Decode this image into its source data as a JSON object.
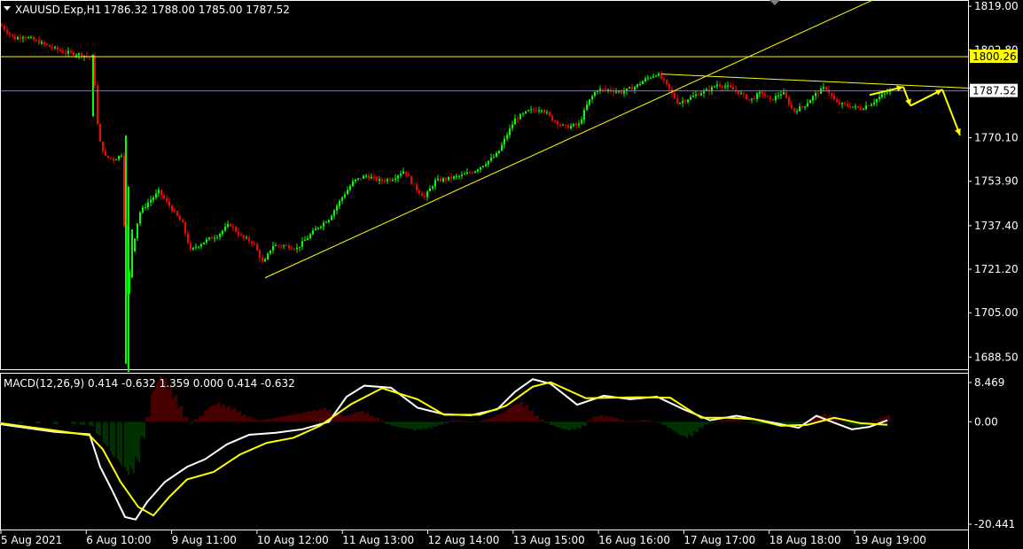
{
  "header": {
    "symbol_label": "XAUUSD.Exp,H1",
    "ohlc_label": "1786.32 1788.00 1785.00 1787.52"
  },
  "macd": {
    "label": "MACD(12,26,9) 0.414 -0.632 1.359 0.000 0.414 -0.632"
  },
  "colors": {
    "background": "#000000",
    "bull_candle": "#00ff00",
    "bear_candle": "#ff0000",
    "trendline": "#ffff00",
    "current_price_line": "#7f7f9f",
    "macd_line": "#ffffff",
    "signal_line": "#ffff00",
    "hist_positive": "#8b0000",
    "hist_negative": "#006400",
    "grid_frame": "#ffffff"
  },
  "chart_data": [
    {
      "type": "candlestick",
      "symbol": "XAUUSD.Exp",
      "timeframe": "H1",
      "y_ticks": [
        "1819.00",
        "1802.80",
        "1787.52",
        "1770.10",
        "1753.90",
        "1737.40",
        "1721.20",
        "1705.00",
        "1688.50"
      ],
      "ylim": [
        1684,
        1821
      ],
      "x_ticks": [
        "5 Aug 2021",
        "6 Aug 10:00",
        "9 Aug 11:00",
        "10 Aug 12:00",
        "11 Aug 13:00",
        "12 Aug 14:00",
        "13 Aug 15:00",
        "16 Aug 16:00",
        "17 Aug 17:00",
        "18 Aug 18:00",
        "19 Aug 19:00"
      ],
      "horizontal_level": {
        "price": 1800.26,
        "label": "1800.26"
      },
      "current_price": {
        "price": 1787.52,
        "label": "1787.52"
      },
      "price_path": [
        [
          0,
          1812
        ],
        [
          15,
          1807
        ],
        [
          25,
          1808
        ],
        [
          40,
          1806
        ],
        [
          55,
          1804
        ],
        [
          70,
          1802
        ],
        [
          90,
          1801
        ],
        [
          104,
          1800
        ],
        [
          110,
          1770
        ],
        [
          118,
          1763
        ],
        [
          128,
          1762
        ],
        [
          136,
          1764
        ],
        [
          142,
          1712
        ],
        [
          148,
          1728
        ],
        [
          156,
          1742
        ],
        [
          166,
          1746
        ],
        [
          178,
          1750
        ],
        [
          192,
          1744
        ],
        [
          205,
          1738
        ],
        [
          214,
          1728
        ],
        [
          222,
          1730
        ],
        [
          232,
          1732
        ],
        [
          245,
          1734
        ],
        [
          258,
          1738
        ],
        [
          272,
          1733
        ],
        [
          285,
          1731
        ],
        [
          296,
          1723
        ],
        [
          306,
          1730
        ],
        [
          320,
          1730
        ],
        [
          334,
          1729
        ],
        [
          346,
          1733
        ],
        [
          358,
          1737
        ],
        [
          370,
          1740
        ],
        [
          385,
          1748
        ],
        [
          398,
          1754
        ],
        [
          412,
          1756
        ],
        [
          428,
          1754
        ],
        [
          442,
          1755
        ],
        [
          455,
          1758
        ],
        [
          466,
          1752
        ],
        [
          478,
          1748
        ],
        [
          490,
          1754
        ],
        [
          505,
          1755
        ],
        [
          520,
          1756
        ],
        [
          535,
          1758
        ],
        [
          548,
          1761
        ],
        [
          560,
          1764
        ],
        [
          572,
          1772
        ],
        [
          580,
          1777
        ],
        [
          595,
          1780
        ],
        [
          610,
          1781
        ],
        [
          622,
          1777
        ],
        [
          636,
          1774
        ],
        [
          652,
          1775
        ],
        [
          662,
          1783
        ],
        [
          672,
          1788
        ],
        [
          685,
          1788
        ],
        [
          700,
          1787
        ],
        [
          715,
          1789
        ],
        [
          728,
          1792
        ],
        [
          740,
          1794
        ],
        [
          748,
          1791
        ],
        [
          756,
          1787
        ],
        [
          764,
          1783
        ],
        [
          778,
          1785
        ],
        [
          790,
          1787
        ],
        [
          800,
          1788
        ],
        [
          808,
          1790
        ],
        [
          820,
          1789
        ],
        [
          832,
          1787
        ],
        [
          845,
          1784
        ],
        [
          858,
          1787
        ],
        [
          868,
          1784
        ],
        [
          882,
          1787
        ],
        [
          894,
          1780
        ],
        [
          906,
          1782
        ],
        [
          918,
          1786
        ],
        [
          930,
          1789
        ],
        [
          942,
          1783
        ],
        [
          956,
          1782
        ],
        [
          970,
          1781
        ],
        [
          982,
          1783
        ],
        [
          995,
          1786
        ],
        [
          1005,
          1788
        ]
      ],
      "trendlines": [
        {
          "from": [
            298,
            1718
          ],
          "to": [
            988,
            1822
          ]
        },
        {
          "from": [
            745,
            1793.8
          ],
          "to": [
            1095,
            1788.5
          ]
        }
      ],
      "projection_arrows": [
        [
          [
            980,
            1786
          ],
          [
            1018,
            1789
          ]
        ],
        [
          [
            1018,
            1789
          ],
          [
            1026,
            1782
          ]
        ],
        [
          [
            1026,
            1782
          ],
          [
            1062,
            1788
          ]
        ],
        [
          [
            1062,
            1788
          ],
          [
            1082,
            1771
          ]
        ]
      ]
    },
    {
      "type": "macd",
      "name": "MACD(12,26,9)",
      "y_ticks": [
        "8.469",
        "0.00",
        "-20.441"
      ],
      "ylim": [
        -21.5,
        9.6
      ],
      "macd_path": [
        [
          0,
          -0.5
        ],
        [
          60,
          -2
        ],
        [
          100,
          -2.5
        ],
        [
          112,
          -9
        ],
        [
          125,
          -13.5
        ],
        [
          140,
          -19
        ],
        [
          152,
          -19.5
        ],
        [
          165,
          -16
        ],
        [
          185,
          -12
        ],
        [
          210,
          -9
        ],
        [
          230,
          -7.5
        ],
        [
          255,
          -4.5
        ],
        [
          280,
          -2.6
        ],
        [
          310,
          -2.2
        ],
        [
          340,
          -1.5
        ],
        [
          370,
          0
        ],
        [
          390,
          5
        ],
        [
          410,
          7.2
        ],
        [
          440,
          6.8
        ],
        [
          470,
          2.8
        ],
        [
          500,
          1.5
        ],
        [
          530,
          1.3
        ],
        [
          560,
          2.5
        ],
        [
          580,
          6
        ],
        [
          600,
          8.5
        ],
        [
          620,
          7.6
        ],
        [
          650,
          3.4
        ],
        [
          680,
          5.2
        ],
        [
          710,
          4.5
        ],
        [
          740,
          5
        ],
        [
          770,
          2.5
        ],
        [
          800,
          0.3
        ],
        [
          830,
          1.2
        ],
        [
          860,
          0.2
        ],
        [
          880,
          -0.5
        ],
        [
          900,
          -1.2
        ],
        [
          920,
          1.2
        ],
        [
          940,
          -0.2
        ],
        [
          960,
          -1.5
        ],
        [
          980,
          -1
        ],
        [
          1000,
          0.3
        ]
      ],
      "signal_path": [
        [
          0,
          -0.3
        ],
        [
          60,
          -1.7
        ],
        [
          100,
          -2.7
        ],
        [
          115,
          -5.5
        ],
        [
          135,
          -12
        ],
        [
          155,
          -17
        ],
        [
          172,
          -18.7
        ],
        [
          190,
          -15
        ],
        [
          210,
          -11.5
        ],
        [
          240,
          -10
        ],
        [
          270,
          -6.5
        ],
        [
          300,
          -4.2
        ],
        [
          330,
          -3.2
        ],
        [
          360,
          -0.8
        ],
        [
          395,
          3.5
        ],
        [
          430,
          6.7
        ],
        [
          470,
          4.5
        ],
        [
          500,
          1.4
        ],
        [
          540,
          1.4
        ],
        [
          570,
          3.2
        ],
        [
          600,
          7
        ],
        [
          620,
          7.9
        ],
        [
          660,
          4.7
        ],
        [
          690,
          4.8
        ],
        [
          720,
          4.9
        ],
        [
          755,
          4.8
        ],
        [
          790,
          0.8
        ],
        [
          820,
          0.8
        ],
        [
          850,
          0.5
        ],
        [
          880,
          -0.8
        ],
        [
          910,
          -0.6
        ],
        [
          940,
          0.8
        ],
        [
          970,
          -0.3
        ],
        [
          1000,
          -0.6
        ]
      ],
      "histogram": [
        [
          0,
          -0.4
        ],
        [
          20,
          -0.4
        ],
        [
          40,
          -0.3
        ],
        [
          60,
          -0.5
        ],
        [
          80,
          -0.4
        ],
        [
          90,
          -0.6
        ],
        [
          100,
          -0.8
        ],
        [
          108,
          -2.6
        ],
        [
          116,
          -4.5
        ],
        [
          124,
          -6.5
        ],
        [
          132,
          -8
        ],
        [
          140,
          -9.8
        ],
        [
          146,
          -9.5
        ],
        [
          152,
          -7.5
        ],
        [
          158,
          -3
        ],
        [
          164,
          1
        ],
        [
          170,
          6
        ],
        [
          176,
          8.5
        ],
        [
          182,
          8.2
        ],
        [
          188,
          7
        ],
        [
          194,
          5
        ],
        [
          200,
          3
        ],
        [
          206,
          1
        ],
        [
          212,
          -0.2
        ],
        [
          218,
          0.5
        ],
        [
          224,
          1.2
        ],
        [
          230,
          2.4
        ],
        [
          236,
          3.2
        ],
        [
          242,
          3.6
        ],
        [
          248,
          3.4
        ],
        [
          254,
          3
        ],
        [
          260,
          2.5
        ],
        [
          266,
          2
        ],
        [
          272,
          1.4
        ],
        [
          278,
          1
        ],
        [
          284,
          0.5
        ],
        [
          290,
          0.3
        ],
        [
          296,
          0.4
        ],
        [
          302,
          0.6
        ],
        [
          308,
          0.8
        ],
        [
          314,
          1
        ],
        [
          320,
          1.2
        ],
        [
          326,
          1.4
        ],
        [
          332,
          1.6
        ],
        [
          338,
          1.8
        ],
        [
          344,
          2
        ],
        [
          350,
          2.2
        ],
        [
          356,
          2.4
        ],
        [
          362,
          2.6
        ],
        [
          368,
          2.3
        ],
        [
          374,
          1.9
        ],
        [
          380,
          1.5
        ],
        [
          386,
          1.2
        ],
        [
          392,
          1.5
        ],
        [
          398,
          1.9
        ],
        [
          404,
          2.1
        ],
        [
          410,
          1.7
        ],
        [
          416,
          1.2
        ],
        [
          422,
          0.8
        ],
        [
          428,
          0.2
        ],
        [
          434,
          -0.4
        ],
        [
          440,
          -0.8
        ],
        [
          446,
          -1
        ],
        [
          452,
          -1.2
        ],
        [
          458,
          -1.4
        ],
        [
          464,
          -1.6
        ],
        [
          470,
          -1.5
        ],
        [
          476,
          -1.4
        ],
        [
          482,
          -1.2
        ],
        [
          488,
          -0.9
        ],
        [
          494,
          -0.6
        ],
        [
          500,
          -0.3
        ],
        [
          506,
          0.2
        ],
        [
          512,
          0.3
        ],
        [
          518,
          0.2
        ],
        [
          524,
          0.1
        ],
        [
          530,
          -0.1
        ],
        [
          536,
          0.1
        ],
        [
          542,
          0.3
        ],
        [
          548,
          0.6
        ],
        [
          554,
          1
        ],
        [
          560,
          1.5
        ],
        [
          566,
          2
        ],
        [
          572,
          2.7
        ],
        [
          578,
          3.4
        ],
        [
          584,
          3.8
        ],
        [
          590,
          3.2
        ],
        [
          596,
          2.2
        ],
        [
          602,
          1.2
        ],
        [
          608,
          0.4
        ],
        [
          614,
          -0.2
        ],
        [
          620,
          -0.7
        ],
        [
          626,
          -1.1
        ],
        [
          632,
          -1.4
        ],
        [
          638,
          -1.6
        ],
        [
          644,
          -1.5
        ],
        [
          650,
          -1.2
        ],
        [
          656,
          -0.8
        ],
        [
          662,
          0.3
        ],
        [
          668,
          1
        ],
        [
          674,
          1.2
        ],
        [
          680,
          1.1
        ],
        [
          686,
          1
        ],
        [
          692,
          0.7
        ],
        [
          698,
          0.4
        ],
        [
          704,
          0.2
        ],
        [
          710,
          0.1
        ],
        [
          716,
          0.2
        ],
        [
          722,
          0.4
        ],
        [
          728,
          0.3
        ],
        [
          734,
          0.1
        ],
        [
          740,
          -0.2
        ],
        [
          746,
          -0.6
        ],
        [
          752,
          -1.2
        ],
        [
          758,
          -1.9
        ],
        [
          764,
          -2.6
        ],
        [
          770,
          -3
        ],
        [
          776,
          -2.7
        ],
        [
          782,
          -2
        ],
        [
          788,
          -1.2
        ],
        [
          794,
          -0.5
        ],
        [
          800,
          -0.3
        ],
        [
          806,
          0.1
        ],
        [
          812,
          0.3
        ],
        [
          818,
          0.5
        ],
        [
          824,
          0.6
        ],
        [
          830,
          0.3
        ],
        [
          836,
          0.1
        ],
        [
          842,
          -0.2
        ],
        [
          848,
          -0.4
        ],
        [
          854,
          -0.5
        ],
        [
          860,
          -0.4
        ],
        [
          866,
          -0.3
        ],
        [
          872,
          -0.2
        ],
        [
          878,
          -0.3
        ],
        [
          884,
          -0.5
        ],
        [
          890,
          -0.6
        ],
        [
          896,
          -0.5
        ],
        [
          902,
          -0.3
        ],
        [
          908,
          0.1
        ],
        [
          914,
          0.6
        ],
        [
          920,
          1.2
        ],
        [
          926,
          1.5
        ],
        [
          932,
          1.3
        ],
        [
          938,
          0.8
        ],
        [
          944,
          0.2
        ],
        [
          950,
          -0.3
        ],
        [
          956,
          -0.7
        ],
        [
          962,
          -0.9
        ],
        [
          968,
          -0.8
        ],
        [
          974,
          -0.5
        ],
        [
          980,
          -0.1
        ],
        [
          986,
          0.4
        ],
        [
          992,
          0.9
        ],
        [
          998,
          1.3
        ]
      ]
    }
  ]
}
